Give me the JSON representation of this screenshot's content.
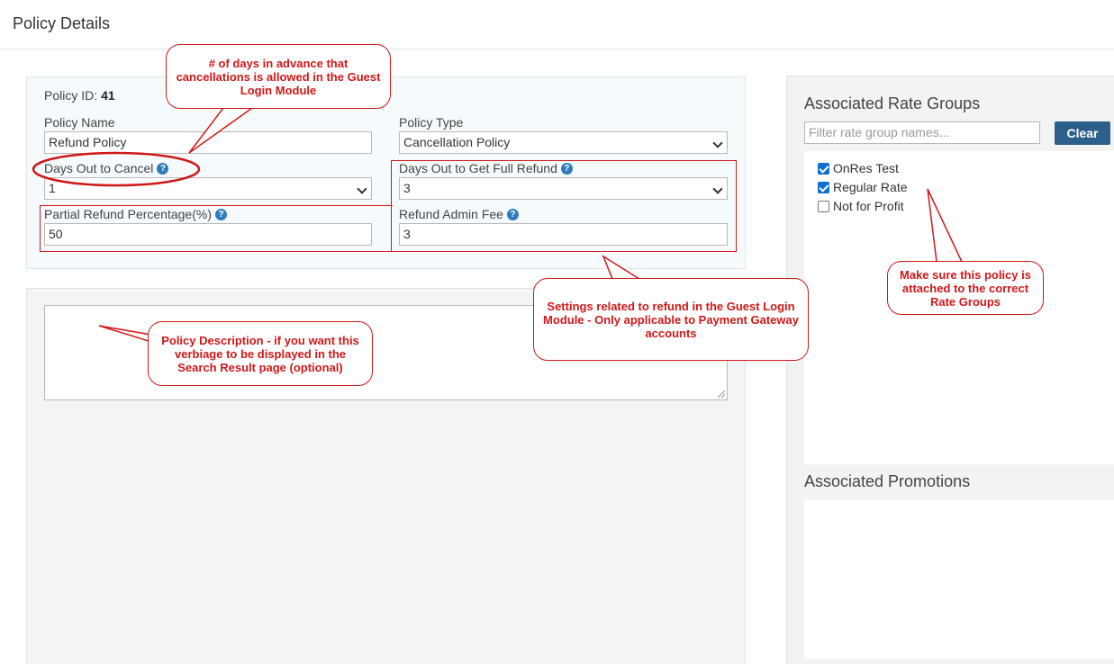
{
  "page": {
    "title": "Policy Details"
  },
  "policy": {
    "id_label": "Policy ID:",
    "id_value": "41",
    "name_label": "Policy Name",
    "name_value": "Refund Policy",
    "type_label": "Policy Type",
    "type_value": "Cancellation Policy",
    "days_cancel_label": "Days Out to Cancel",
    "days_cancel_value": "1",
    "days_refund_label": "Days Out to Get Full Refund",
    "days_refund_value": "3",
    "partial_label": "Partial Refund Percentage(%)",
    "partial_value": "50",
    "admin_fee_label": "Refund Admin Fee",
    "admin_fee_value": "3",
    "help_glyph": "?"
  },
  "rate_groups": {
    "title": "Associated Rate Groups",
    "filter_placeholder": "Filter rate group names...",
    "clear_label": "Clear",
    "items": [
      {
        "label": "OnRes Test",
        "checked": true
      },
      {
        "label": "Regular Rate",
        "checked": true
      },
      {
        "label": "Not for Profit",
        "checked": false
      }
    ]
  },
  "promotions": {
    "title": "Associated Promotions"
  },
  "annotations": {
    "days_advance": "# of days in advance that cancellations is allowed in the Guest Login Module",
    "refund_settings": "Settings related to refund in the Guest Login Module - Only applicable to Payment Gateway accounts",
    "description": "Policy Description - if you want this verbiage to be displayed in the Search Result page (optional)",
    "rate_groups": "Make sure this policy is attached to the correct Rate Groups"
  },
  "colors": {
    "annotation": "#d01818",
    "clear_button": "#2c5f8a",
    "help_icon": "#2f7bbd",
    "checkbox": "#0b6fd4"
  }
}
